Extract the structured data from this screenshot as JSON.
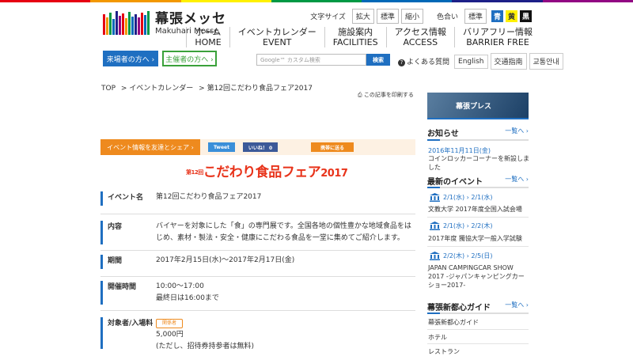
{
  "colors": {
    "accent_blue": "#1f6fc1",
    "accent_orange": "#ee8a1e",
    "accent_green": "#3aa13a",
    "title_red": "#e8331a",
    "top_bar": [
      "#e60012",
      "#f39800",
      "#fff100",
      "#009944",
      "#0068b7",
      "#1d2088",
      "#920783"
    ]
  },
  "header": {
    "logo_jp": "幕張メッセ",
    "logo_en": "Makuhari Messe",
    "text_size_label": "文字サイズ",
    "size_large": "拡大",
    "size_standard": "標準",
    "size_small": "縮小",
    "color_label": "色合い",
    "color_standard": "標準",
    "color_blue": "青",
    "color_yellow": "黄",
    "color_black": "黒",
    "nav": [
      {
        "jp": "ホーム",
        "en": "HOME"
      },
      {
        "jp": "イベントカレンダー",
        "en": "EVENT"
      },
      {
        "jp": "施設案内",
        "en": "FACILITIES"
      },
      {
        "jp": "アクセス情報",
        "en": "ACCESS"
      },
      {
        "jp": "バリアフリー情報",
        "en": "BARRIER FREE"
      }
    ],
    "visitor_button": "来場者の方へ ›",
    "organizer_button": "主催者の方へ ›",
    "search_placeholder": "Google™ カスタム検索",
    "search_button": "検索",
    "faq": "よくある質問",
    "english": "English",
    "transport": "交通指南",
    "korean": "교통안내"
  },
  "breadcrumb": [
    "TOP",
    "> イベントカレンダー",
    "> 第12回こだわり食品フェア2017"
  ],
  "print_link": "この記事を印刷する",
  "share": {
    "tab": "イベント情報を友達とシェア ›",
    "tweet": "Tweet",
    "like": "いいね！ 0",
    "mail": "携帯に送る"
  },
  "event_banner": {
    "prefix": "第12回",
    "title": "こだわり食品フェア",
    "year": "2017"
  },
  "details": [
    {
      "label": "イベント名",
      "value": "第12回こだわり食品フェア2017"
    },
    {
      "label": "内容",
      "value": "バイヤーを対象にした「食」の専門展です。全国各地の個性豊かな地域食品をはじめ、素材・製法・安全・健康にこだわる食品を一堂に集めてご紹介します。"
    },
    {
      "label": "期間",
      "value": "2017年2月15日(水)〜2017年2月17日(金)"
    },
    {
      "label": "開催時間",
      "value": "10:00〜17:00",
      "value2": "最終日は16:00まで"
    },
    {
      "label": "対象者/入場料",
      "badge": "関係者",
      "value": "5,000円",
      "value2": "(ただし、招待券持参者は無料)"
    }
  ],
  "sidebar": {
    "press": "幕張プレス",
    "news_title": "お知らせ",
    "more": "一覧へ ›",
    "news_date": "2016年11月11日(金)",
    "news_text": "コインロッカーコーナーを新設しました",
    "events_title": "最新のイベント",
    "events": [
      {
        "date": "2/1(水) › 2/1(水)",
        "name": "文教大学 2017年度全国入試会場"
      },
      {
        "date": "2/1(水) › 2/2(木)",
        "name": "2017年度 獨協大学一般入学試験"
      },
      {
        "date": "2/2(木) › 2/5(日)",
        "name": "JAPAN CAMPINGCAR SHOW 2017 -ジャパンキャンピングカーショー2017-"
      }
    ],
    "guide_title": "幕張新都心ガイド",
    "guide_items": [
      "幕張新都心ガイド",
      "ホテル",
      "レストラン"
    ]
  }
}
